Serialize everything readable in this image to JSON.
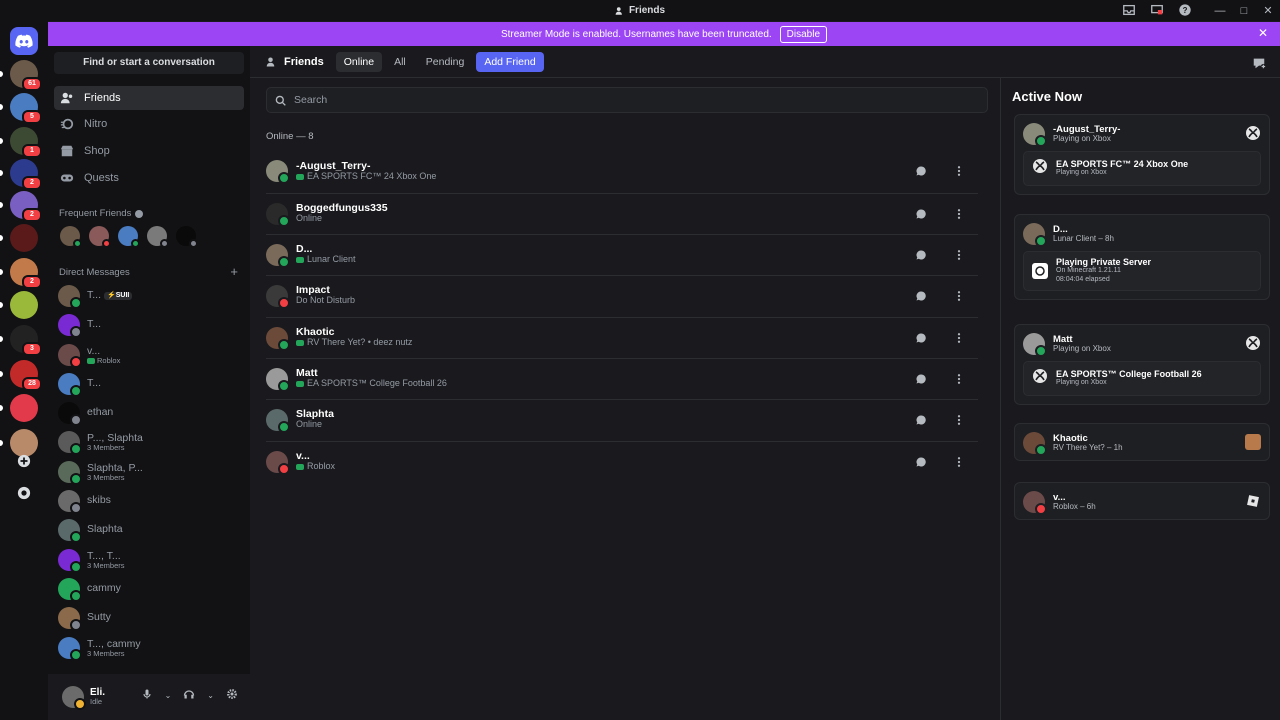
{
  "window": {
    "title": "Friends"
  },
  "banner": {
    "message": "Streamer Mode is enabled. Usernames have been truncated.",
    "disable_label": "Disable"
  },
  "servers": [
    {
      "badge": "61",
      "color": "#6b5a4a"
    },
    {
      "badge": "5",
      "color": "#4a7cc2"
    },
    {
      "badge": "1",
      "color": "#3d4a33"
    },
    {
      "badge": "2",
      "color": "#2d3b8f"
    },
    {
      "badge": "2",
      "color": "#7a5fc2"
    },
    {
      "badge": "",
      "color": "#5a1a1a"
    },
    {
      "badge": "2",
      "color": "#c27a4a"
    },
    {
      "badge": "",
      "color": "#9ab83a"
    },
    {
      "badge": "3",
      "color": "#222222"
    },
    {
      "badge": "28",
      "color": "#c22a2a"
    },
    {
      "badge": "",
      "color": "#e23a4a"
    },
    {
      "badge": "",
      "color": "#b88a6a"
    }
  ],
  "sidebar": {
    "find_label": "Find or start a conversation",
    "nav": [
      {
        "label": "Friends"
      },
      {
        "label": "Nitro"
      },
      {
        "label": "Shop"
      },
      {
        "label": "Quests"
      }
    ],
    "frequent_title": "Frequent Friends",
    "dm_title": "Direct Messages",
    "dms": [
      {
        "name": "T...",
        "sub": "",
        "tag": "⚡SUII",
        "status": "online",
        "color": "#6b5a4a"
      },
      {
        "name": "T...",
        "sub": "",
        "tag": "",
        "status": "offline",
        "color": "#7a2ad2"
      },
      {
        "name": "v...",
        "sub": "Roblox",
        "tag": "",
        "status": "dnd",
        "color": "#6b4a4a"
      },
      {
        "name": "T...",
        "sub": "",
        "tag": "",
        "status": "online",
        "color": "#4a7cc2"
      },
      {
        "name": "ethan",
        "sub": "",
        "tag": "",
        "status": "offline",
        "color": "#0a0a0a"
      },
      {
        "name": "P..., Slaphta",
        "sub": "3 Members",
        "tag": "",
        "status": "online",
        "color": "#5a5a5a"
      },
      {
        "name": "Slaphta, P...",
        "sub": "3 Members",
        "tag": "",
        "status": "online",
        "color": "#5a6a5a"
      },
      {
        "name": "skibs",
        "sub": "",
        "tag": "",
        "status": "offline",
        "color": "#6a6a6a"
      },
      {
        "name": "Slaphta",
        "sub": "",
        "tag": "",
        "status": "online",
        "color": "#5a6a6a"
      },
      {
        "name": "T..., T...",
        "sub": "3 Members",
        "tag": "",
        "status": "online",
        "color": "#7a2ad2"
      },
      {
        "name": "cammy",
        "sub": "",
        "tag": "",
        "status": "online",
        "color": "#23a55a"
      },
      {
        "name": "Sutty",
        "sub": "",
        "tag": "",
        "status": "offline",
        "color": "#8a6a4a"
      },
      {
        "name": "T..., cammy",
        "sub": "3 Members",
        "tag": "",
        "status": "online",
        "color": "#4a7cc2"
      }
    ]
  },
  "user": {
    "name": "Eli.",
    "status": "Idle"
  },
  "topbar": {
    "title": "Friends",
    "tabs": [
      "Online",
      "All",
      "Pending"
    ],
    "add_friend": "Add Friend"
  },
  "search": {
    "placeholder": "Search"
  },
  "friends": {
    "count_label": "Online — 8",
    "list": [
      {
        "name": "-August_Terry-",
        "activity": "EA SPORTS FC™ 24 Xbox One",
        "game": true,
        "status": "online",
        "color": "#8a8a7a"
      },
      {
        "name": "Boggedfungus335",
        "activity": "Online",
        "game": false,
        "status": "online",
        "color": "#2a2a2a"
      },
      {
        "name": "D...",
        "activity": "Lunar Client",
        "game": true,
        "status": "online",
        "color": "#7a6a5a"
      },
      {
        "name": "Impact",
        "activity": "Do Not Disturb",
        "game": false,
        "status": "dnd",
        "color": "#3a3a3a"
      },
      {
        "name": "Khaotic",
        "activity": "RV There Yet? • deez nutz",
        "game": true,
        "status": "online",
        "color": "#6b4a3a"
      },
      {
        "name": "Matt",
        "activity": "EA SPORTS™ College Football 26",
        "game": true,
        "status": "online",
        "color": "#9a9a9a"
      },
      {
        "name": "Slaphta",
        "activity": "Online",
        "game": false,
        "status": "online",
        "color": "#5a6a6a"
      },
      {
        "name": "v...",
        "activity": "Roblox",
        "game": true,
        "status": "dnd",
        "color": "#6b4a4a"
      }
    ]
  },
  "active_now": {
    "title": "Active Now",
    "cards": [
      {
        "name": "-August_Terry-",
        "sub": "Playing on Xbox",
        "right": "xbox",
        "game": "EA SPORTS FC™ 24 Xbox One",
        "game_sub1": "Playing on Xbox",
        "game_sub2": "",
        "game_icon": "xbox"
      },
      {
        "name": "D...",
        "sub": "Lunar Client – 8h",
        "right": "",
        "game": "Playing Private Server",
        "game_sub1": "On Minecraft 1.21.11",
        "game_sub2": "08:04:04 elapsed",
        "game_icon": "minecraft"
      },
      {
        "name": "Matt",
        "sub": "Playing on Xbox",
        "right": "xbox",
        "game": "EA SPORTS™ College Football 26",
        "game_sub1": "Playing on Xbox",
        "game_sub2": "",
        "game_icon": "xbox"
      },
      {
        "name": "Khaotic",
        "sub": "RV There Yet? – 1h",
        "right": "rv-game",
        "game": "",
        "game_sub1": "",
        "game_sub2": "",
        "game_icon": ""
      },
      {
        "name": "v...",
        "sub": "Roblox – 6h",
        "right": "roblox",
        "game": "",
        "game_sub1": "",
        "game_sub2": "",
        "game_icon": ""
      }
    ]
  }
}
